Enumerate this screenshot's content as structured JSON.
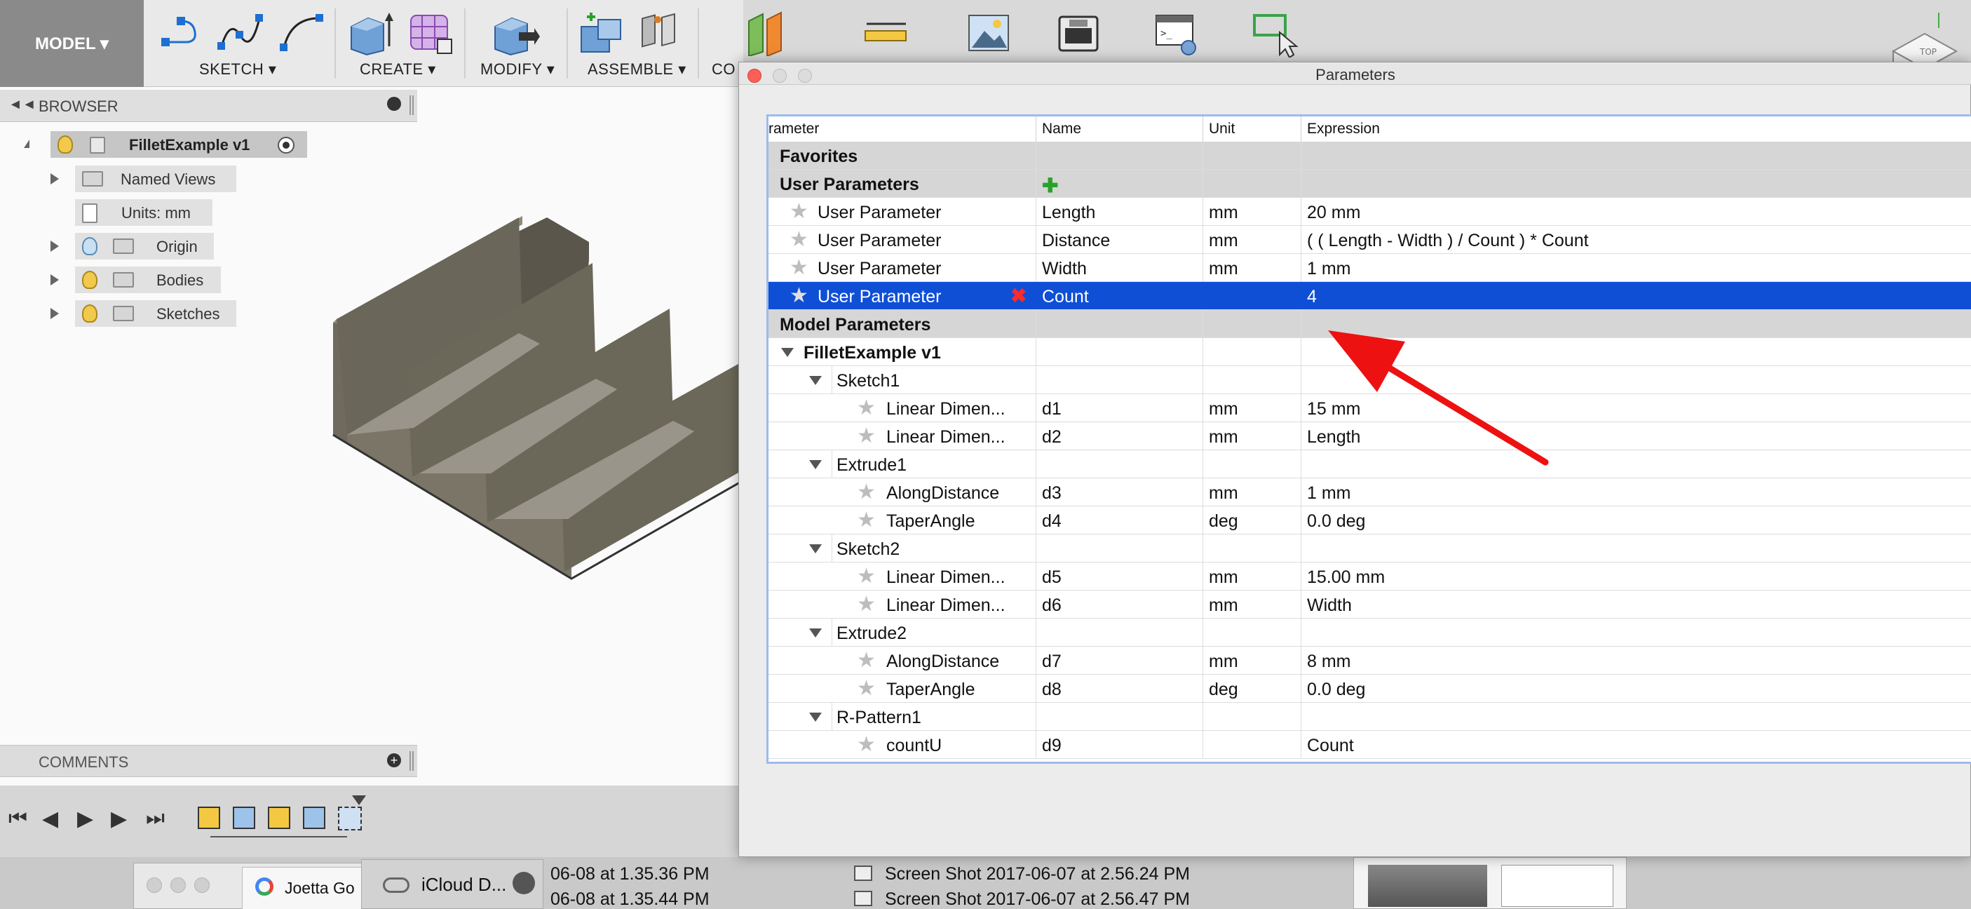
{
  "toolbar": {
    "workspace": "MODEL",
    "groups": [
      {
        "label": "SKETCH"
      },
      {
        "label": "CREATE"
      },
      {
        "label": "MODIFY"
      },
      {
        "label": "ASSEMBLE"
      },
      {
        "label": "CO"
      }
    ]
  },
  "browser": {
    "title": "BROWSER",
    "root": "FilletExample v1",
    "items": [
      {
        "label": "Named Views"
      },
      {
        "label": "Units: mm"
      },
      {
        "label": "Origin"
      },
      {
        "label": "Bodies"
      },
      {
        "label": "Sketches"
      }
    ]
  },
  "comments": {
    "title": "COMMENTS"
  },
  "dialog": {
    "title": "Parameters",
    "columns": {
      "parameter": "rameter",
      "name": "Name",
      "unit": "Unit",
      "expression": "Expression"
    },
    "sections": {
      "favorites": "Favorites",
      "user": "User Parameters",
      "model": "Model Parameters"
    },
    "user_params": [
      {
        "param": "User Parameter",
        "name": "Length",
        "unit": "mm",
        "expr": "20 mm"
      },
      {
        "param": "User Parameter",
        "name": "Distance",
        "unit": "mm",
        "expr": "( ( Length - Width ) / Count ) * Count"
      },
      {
        "param": "User Parameter",
        "name": "Width",
        "unit": "mm",
        "expr": "1 mm"
      },
      {
        "param": "User Parameter",
        "name": "Count",
        "unit": "",
        "expr": "4"
      }
    ],
    "model_root": "FilletExample v1",
    "model_groups": [
      {
        "name": "Sketch1",
        "rows": [
          {
            "param": "Linear Dimen...",
            "name": "d1",
            "unit": "mm",
            "expr": "15 mm"
          },
          {
            "param": "Linear Dimen...",
            "name": "d2",
            "unit": "mm",
            "expr": "Length"
          }
        ]
      },
      {
        "name": "Extrude1",
        "rows": [
          {
            "param": "AlongDistance",
            "name": "d3",
            "unit": "mm",
            "expr": "1 mm"
          },
          {
            "param": "TaperAngle",
            "name": "d4",
            "unit": "deg",
            "expr": "0.0 deg"
          }
        ]
      },
      {
        "name": "Sketch2",
        "rows": [
          {
            "param": "Linear Dimen...",
            "name": "d5",
            "unit": "mm",
            "expr": "15.00 mm"
          },
          {
            "param": "Linear Dimen...",
            "name": "d6",
            "unit": "mm",
            "expr": "Width"
          }
        ]
      },
      {
        "name": "Extrude2",
        "rows": [
          {
            "param": "AlongDistance",
            "name": "d7",
            "unit": "mm",
            "expr": "8 mm"
          },
          {
            "param": "TaperAngle",
            "name": "d8",
            "unit": "deg",
            "expr": "0.0 deg"
          }
        ]
      },
      {
        "name": "R-Pattern1",
        "rows": [
          {
            "param": "countU",
            "name": "d9",
            "unit": "",
            "expr": "Count"
          }
        ]
      }
    ]
  },
  "desktop": {
    "chrome_tab": "Joetta Go",
    "icloud": "iCloud D...",
    "files_left": [
      "06-08 at 1.35.36 PM",
      "06-08 at 1.35.44 PM"
    ],
    "files_right": [
      "Screen Shot 2017-06-07 at 2.56.24 PM",
      "Screen Shot 2017-06-07 at 2.56.47 PM"
    ]
  },
  "colors": {
    "selection": "#0f4fd6",
    "arrow": "#ee1111",
    "add_icon": "#2aa12a",
    "delete_icon": "#ff2a2a"
  }
}
